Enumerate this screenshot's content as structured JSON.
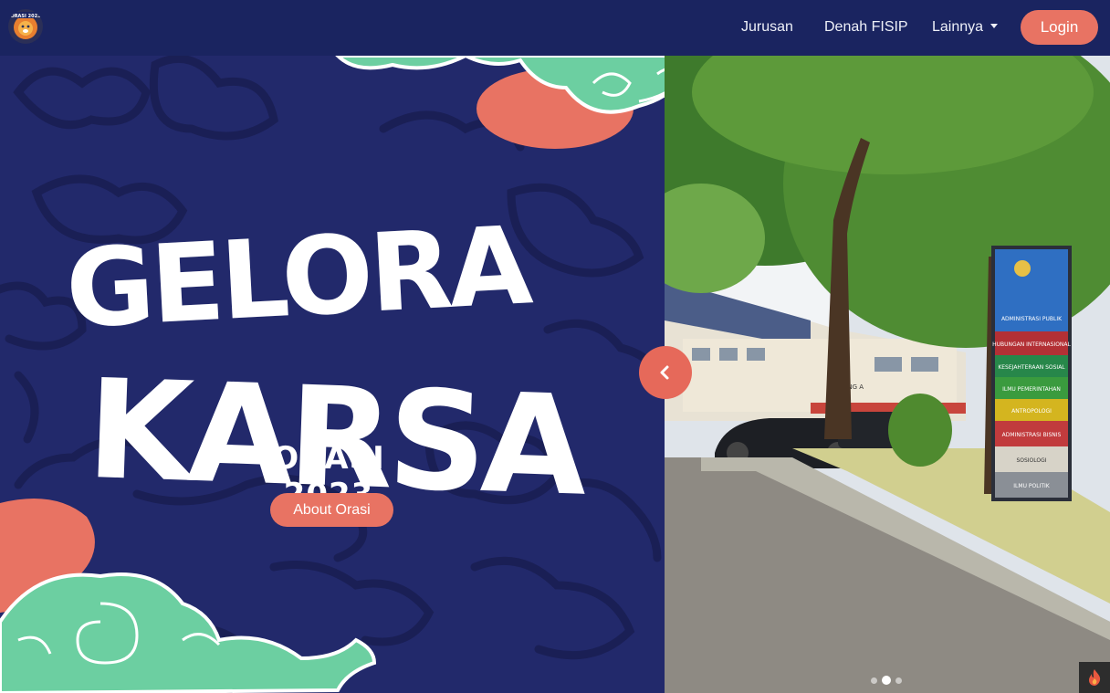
{
  "nav": {
    "logo_label": "ORASI 2023",
    "items": [
      {
        "label": "Jurusan"
      },
      {
        "label": "Denah FISIP"
      },
      {
        "label": "Lainnya"
      }
    ],
    "login_label": "Login"
  },
  "hero": {
    "headline_line1": "GELORA",
    "headline_line2": "KARSA",
    "subtitle": "ORASI 2023",
    "about_label": "About Orasi"
  },
  "campus_sign": {
    "lines": [
      "ADMINISTRASI PUBLIK",
      "HUBUNGAN INTERNASIONAL",
      "KESEJAHTERAAN SOSIAL",
      "ILMU PEMERINTAHAN",
      "ANTROPOLOGI",
      "ADMINISTRASI BISNIS",
      "SOSIOLOGI",
      "ILMU POLITIK"
    ],
    "building_label": "GEDUNG A"
  },
  "carousel": {
    "slide_count": 3,
    "active_index": 1
  },
  "colors": {
    "navbar": "#1a2460",
    "hero_bg": "#22296b",
    "accent": "#e87363",
    "cloud": "#6ccfa1",
    "pattern": "#1a1f55"
  }
}
